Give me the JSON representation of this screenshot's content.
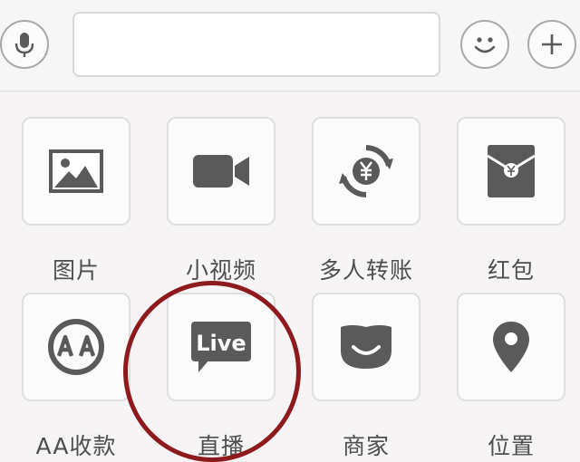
{
  "input": {
    "value": "",
    "placeholder": ""
  },
  "toolbar": {
    "voice_icon": "microphone-icon",
    "emoji_icon": "smiley-icon",
    "plus_icon": "plus-icon"
  },
  "grid": [
    {
      "label": "图片",
      "icon": "image-icon"
    },
    {
      "label": "小视频",
      "icon": "video-camera-icon"
    },
    {
      "label": "多人转账",
      "icon": "transfer-yuan-icon"
    },
    {
      "label": "红包",
      "icon": "red-envelope-icon"
    },
    {
      "label": "AA收款",
      "icon": "aa-collection-icon"
    },
    {
      "label": "直播",
      "icon": "live-icon",
      "icon_text": "Live"
    },
    {
      "label": "商家",
      "icon": "merchant-icon"
    },
    {
      "label": "位置",
      "icon": "location-pin-icon"
    }
  ],
  "colors": {
    "icon": "#5a5a5a",
    "annotation_circle": "#8e1a1e"
  }
}
